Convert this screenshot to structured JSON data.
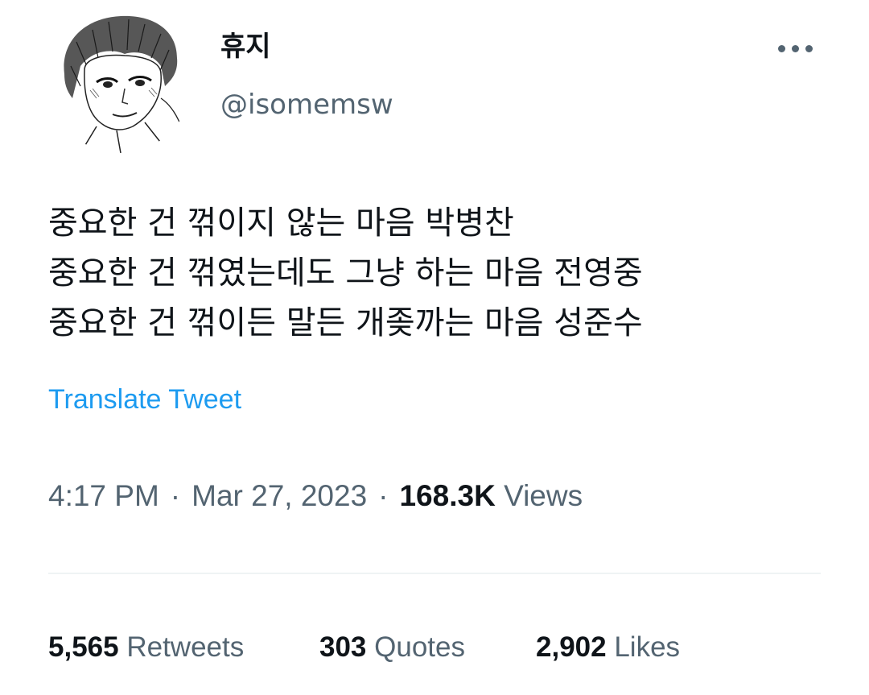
{
  "author": {
    "display_name": "휴지",
    "handle": "@isomemsw",
    "avatar_icon": "manga-sketch-avatar"
  },
  "tweet": {
    "lines": [
      "중요한 건 꺾이지 않는 마음 박병찬",
      "중요한 건 꺾였는데도 그냥 하는 마음 전영중",
      "중요한 건 꺾이든 말든 개좆까는 마음 성준수"
    ],
    "translate_label": "Translate Tweet"
  },
  "meta": {
    "time": "4:17 PM",
    "separator": "·",
    "date": "Mar 27, 2023",
    "views_count": "168.3K",
    "views_label": "Views"
  },
  "stats": {
    "retweets": {
      "count": "5,565",
      "label": "Retweets"
    },
    "quotes": {
      "count": "303",
      "label": "Quotes"
    },
    "likes": {
      "count": "2,902",
      "label": "Likes"
    }
  },
  "colors": {
    "text_primary": "#0f1419",
    "text_secondary": "#536471",
    "link": "#1d9bf0",
    "divider": "#eff3f4"
  },
  "icons": {
    "more": "more-horizontal-icon"
  }
}
